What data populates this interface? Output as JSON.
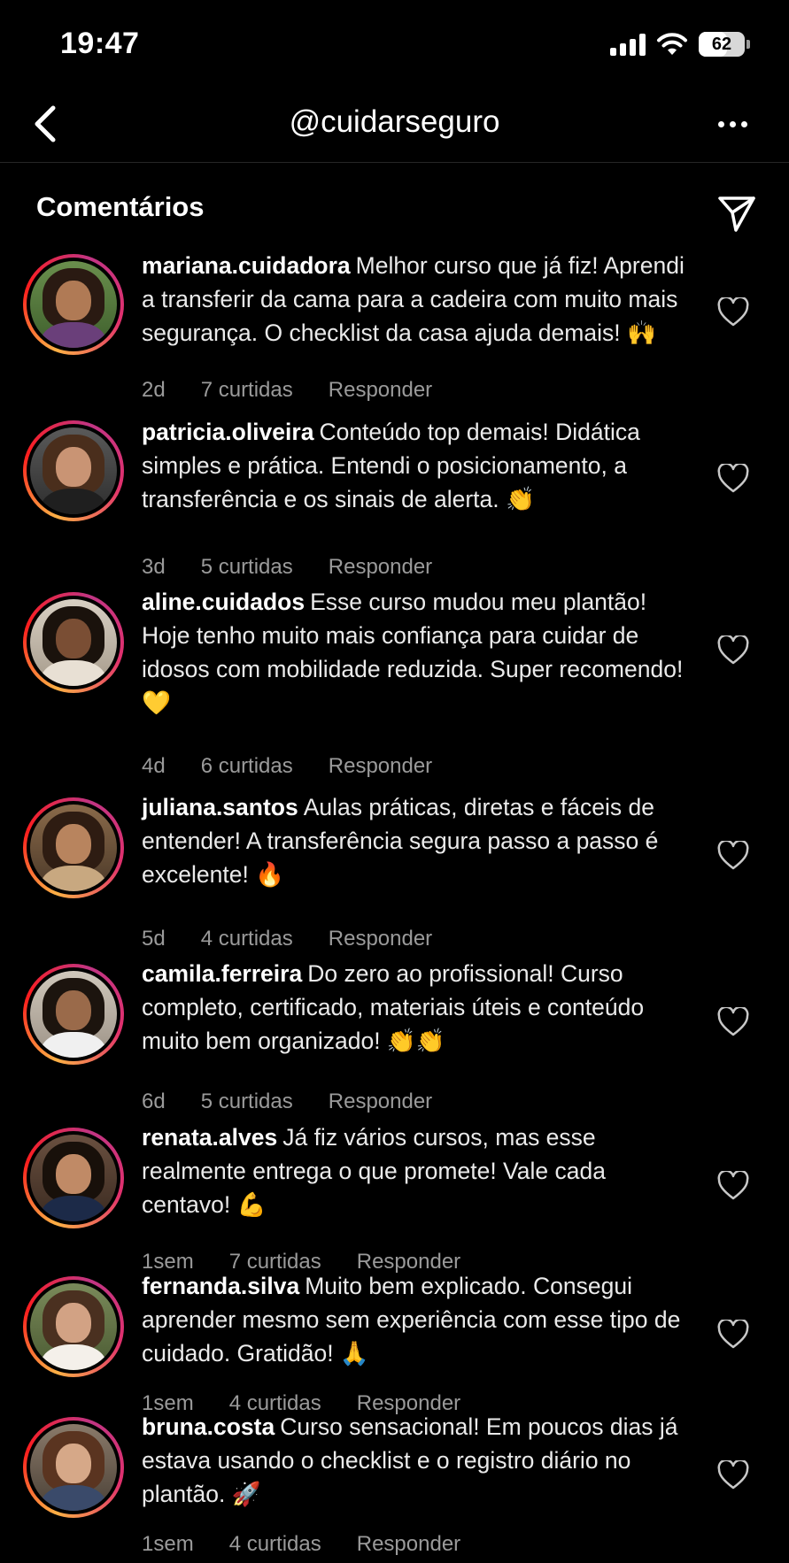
{
  "status_bar": {
    "time": "19:47",
    "battery": "62",
    "battery_level": 0.62
  },
  "nav": {
    "title": "@cuidarseguro",
    "back_icon": "chevron-left-icon",
    "more_icon": "ellipsis-icon"
  },
  "section": {
    "title": "Comentários",
    "share_icon": "paper-plane-icon"
  },
  "colors": {
    "background": "#000000",
    "text": "#eaeaea",
    "muted": "#9a9a9a"
  },
  "comments": [
    {
      "username": "mariana.cuidadora",
      "text": "Melhor curso que já fiz! Aprendi a transferir da cama para a cadeira com muito mais segurança. O checklist da casa ajuda demais! 🙌",
      "time": "2d",
      "likes": "7 curtidas",
      "reply": "Responder"
    },
    {
      "username": "patricia.oliveira",
      "text": "Conteúdo top demais! Didática simples e prática. Entendi o posicionamento, a transferência e os sinais de alerta. 👏",
      "time": "3d",
      "likes": "5 curtidas",
      "reply": "Responder"
    },
    {
      "username": "aline.cuidados",
      "text": "Esse curso mudou meu plantão! Hoje tenho muito mais confiança para cuidar de idosos com mobilidade reduzida. Super recomendo! 💛",
      "time": "4d",
      "likes": "6 curtidas",
      "reply": "Responder"
    },
    {
      "username": "juliana.santos",
      "text": "Aulas práticas, diretas e fáceis de entender! A transferência segura passo a passo é excelente! 🔥",
      "time": "5d",
      "likes": "4 curtidas",
      "reply": "Responder"
    },
    {
      "username": "camila.ferreira",
      "text": "Do zero ao profissional! Curso completo, certificado, materiais úteis e conteúdo muito bem organizado! 👏👏",
      "time": "6d",
      "likes": "5 curtidas",
      "reply": "Responder"
    },
    {
      "username": "renata.alves",
      "text": "Já fiz vários cursos, mas esse realmente entrega o que promete! Vale cada centavo! 💪",
      "time": "1sem",
      "likes": "7 curtidas",
      "reply": "Responder"
    },
    {
      "username": "fernanda.silva",
      "text": "Muito bem explicado. Consegui aprender mesmo sem experiência com esse tipo de cuidado. Gratidão! 🙏",
      "time": "1sem",
      "likes": "4 curtidas",
      "reply": "Responder"
    },
    {
      "username": "bruna.costa",
      "text": "Curso sensacional! Em poucos dias já estava usando o checklist e o registro diário no plantão. 🚀",
      "time": "1sem",
      "likes": "4 curtidas",
      "reply": "Responder"
    }
  ]
}
